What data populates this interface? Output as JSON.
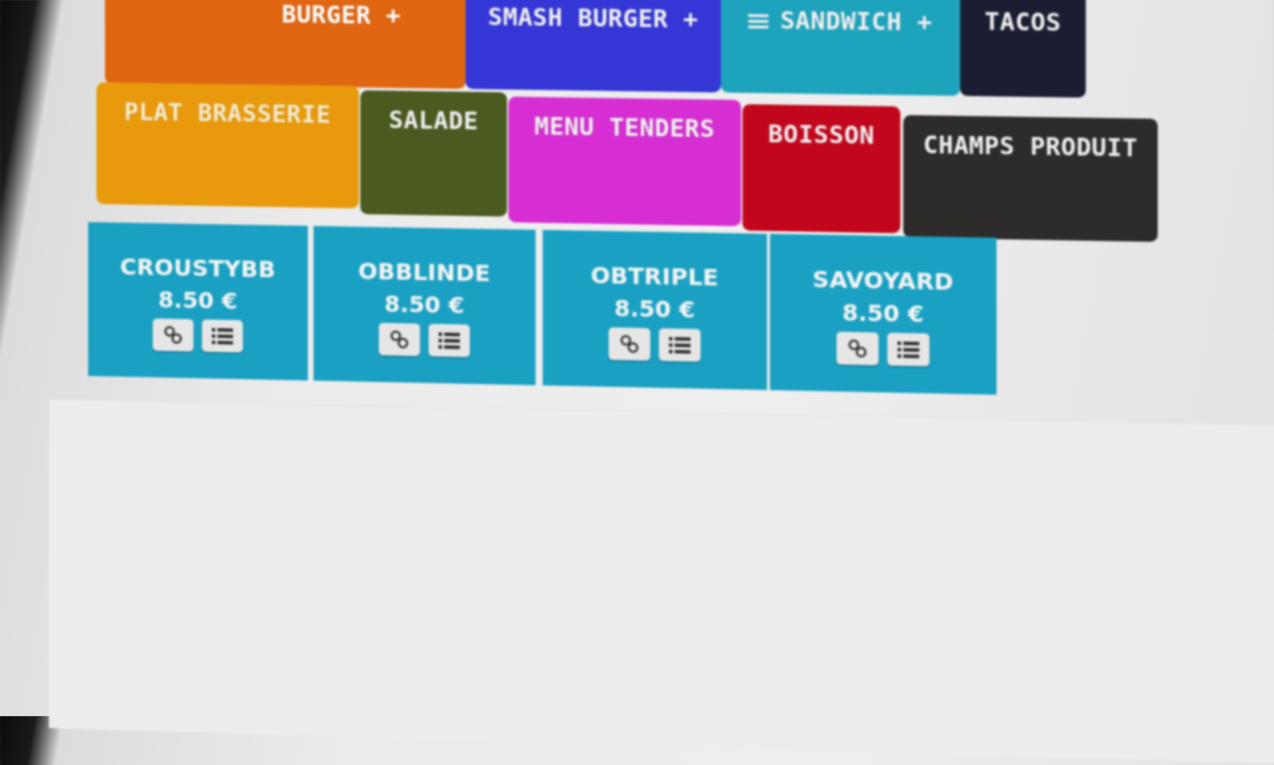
{
  "colors": {
    "burger": "#e06612",
    "smash_burger": "#3436d6",
    "sandwich": "#1ea3bd",
    "tacos": "#1b1e33",
    "plat_brasserie": "#e99a0c",
    "salade": "#4a5a20",
    "menu_tenders": "#d62ed2",
    "boisson": "#c2061c",
    "champs_produit": "#2e2b2b",
    "product_tile": "#1aa0c2"
  },
  "categories_row1": [
    {
      "label": "BURGER +"
    },
    {
      "label": "SMASH BURGER +"
    },
    {
      "label": "SANDWICH +",
      "icon": "menu-lines-icon"
    },
    {
      "label": "TACOS"
    }
  ],
  "categories_row2": [
    {
      "label": "PLAT BRASSERIE"
    },
    {
      "label": "SALADE"
    },
    {
      "label": "MENU TENDERS"
    },
    {
      "label": "BOISSON"
    },
    {
      "label": "CHAMPS PRODUIT"
    }
  ],
  "products": [
    {
      "name": "CROUSTYBB",
      "price": "8.50 €"
    },
    {
      "name": "OBBLINDE",
      "price": "8.50 €"
    },
    {
      "name": "OBTRIPLE",
      "price": "8.50 €"
    },
    {
      "name": "SAVOYARD",
      "price": "8.50 €"
    }
  ],
  "product_actions": [
    "link-icon",
    "list-icon"
  ]
}
